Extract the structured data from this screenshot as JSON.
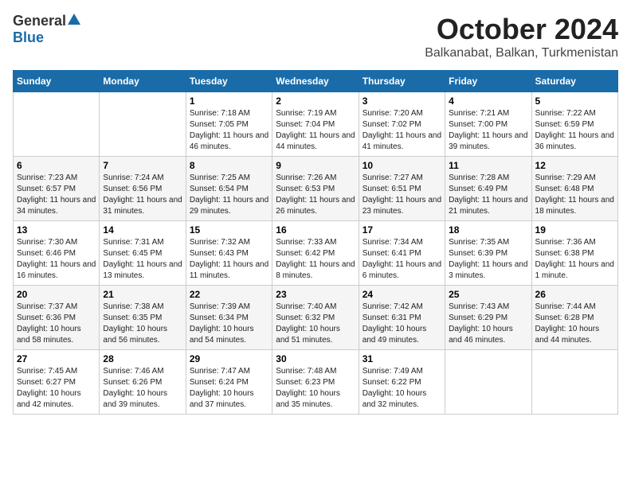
{
  "header": {
    "logo_general": "General",
    "logo_blue": "Blue",
    "month": "October 2024",
    "location": "Balkanabat, Balkan, Turkmenistan"
  },
  "weekdays": [
    "Sunday",
    "Monday",
    "Tuesday",
    "Wednesday",
    "Thursday",
    "Friday",
    "Saturday"
  ],
  "weeks": [
    [
      {
        "day": "",
        "info": ""
      },
      {
        "day": "",
        "info": ""
      },
      {
        "day": "1",
        "info": "Sunrise: 7:18 AM\nSunset: 7:05 PM\nDaylight: 11 hours and 46 minutes."
      },
      {
        "day": "2",
        "info": "Sunrise: 7:19 AM\nSunset: 7:04 PM\nDaylight: 11 hours and 44 minutes."
      },
      {
        "day": "3",
        "info": "Sunrise: 7:20 AM\nSunset: 7:02 PM\nDaylight: 11 hours and 41 minutes."
      },
      {
        "day": "4",
        "info": "Sunrise: 7:21 AM\nSunset: 7:00 PM\nDaylight: 11 hours and 39 minutes."
      },
      {
        "day": "5",
        "info": "Sunrise: 7:22 AM\nSunset: 6:59 PM\nDaylight: 11 hours and 36 minutes."
      }
    ],
    [
      {
        "day": "6",
        "info": "Sunrise: 7:23 AM\nSunset: 6:57 PM\nDaylight: 11 hours and 34 minutes."
      },
      {
        "day": "7",
        "info": "Sunrise: 7:24 AM\nSunset: 6:56 PM\nDaylight: 11 hours and 31 minutes."
      },
      {
        "day": "8",
        "info": "Sunrise: 7:25 AM\nSunset: 6:54 PM\nDaylight: 11 hours and 29 minutes."
      },
      {
        "day": "9",
        "info": "Sunrise: 7:26 AM\nSunset: 6:53 PM\nDaylight: 11 hours and 26 minutes."
      },
      {
        "day": "10",
        "info": "Sunrise: 7:27 AM\nSunset: 6:51 PM\nDaylight: 11 hours and 23 minutes."
      },
      {
        "day": "11",
        "info": "Sunrise: 7:28 AM\nSunset: 6:49 PM\nDaylight: 11 hours and 21 minutes."
      },
      {
        "day": "12",
        "info": "Sunrise: 7:29 AM\nSunset: 6:48 PM\nDaylight: 11 hours and 18 minutes."
      }
    ],
    [
      {
        "day": "13",
        "info": "Sunrise: 7:30 AM\nSunset: 6:46 PM\nDaylight: 11 hours and 16 minutes."
      },
      {
        "day": "14",
        "info": "Sunrise: 7:31 AM\nSunset: 6:45 PM\nDaylight: 11 hours and 13 minutes."
      },
      {
        "day": "15",
        "info": "Sunrise: 7:32 AM\nSunset: 6:43 PM\nDaylight: 11 hours and 11 minutes."
      },
      {
        "day": "16",
        "info": "Sunrise: 7:33 AM\nSunset: 6:42 PM\nDaylight: 11 hours and 8 minutes."
      },
      {
        "day": "17",
        "info": "Sunrise: 7:34 AM\nSunset: 6:41 PM\nDaylight: 11 hours and 6 minutes."
      },
      {
        "day": "18",
        "info": "Sunrise: 7:35 AM\nSunset: 6:39 PM\nDaylight: 11 hours and 3 minutes."
      },
      {
        "day": "19",
        "info": "Sunrise: 7:36 AM\nSunset: 6:38 PM\nDaylight: 11 hours and 1 minute."
      }
    ],
    [
      {
        "day": "20",
        "info": "Sunrise: 7:37 AM\nSunset: 6:36 PM\nDaylight: 10 hours and 58 minutes."
      },
      {
        "day": "21",
        "info": "Sunrise: 7:38 AM\nSunset: 6:35 PM\nDaylight: 10 hours and 56 minutes."
      },
      {
        "day": "22",
        "info": "Sunrise: 7:39 AM\nSunset: 6:34 PM\nDaylight: 10 hours and 54 minutes."
      },
      {
        "day": "23",
        "info": "Sunrise: 7:40 AM\nSunset: 6:32 PM\nDaylight: 10 hours and 51 minutes."
      },
      {
        "day": "24",
        "info": "Sunrise: 7:42 AM\nSunset: 6:31 PM\nDaylight: 10 hours and 49 minutes."
      },
      {
        "day": "25",
        "info": "Sunrise: 7:43 AM\nSunset: 6:29 PM\nDaylight: 10 hours and 46 minutes."
      },
      {
        "day": "26",
        "info": "Sunrise: 7:44 AM\nSunset: 6:28 PM\nDaylight: 10 hours and 44 minutes."
      }
    ],
    [
      {
        "day": "27",
        "info": "Sunrise: 7:45 AM\nSunset: 6:27 PM\nDaylight: 10 hours and 42 minutes."
      },
      {
        "day": "28",
        "info": "Sunrise: 7:46 AM\nSunset: 6:26 PM\nDaylight: 10 hours and 39 minutes."
      },
      {
        "day": "29",
        "info": "Sunrise: 7:47 AM\nSunset: 6:24 PM\nDaylight: 10 hours and 37 minutes."
      },
      {
        "day": "30",
        "info": "Sunrise: 7:48 AM\nSunset: 6:23 PM\nDaylight: 10 hours and 35 minutes."
      },
      {
        "day": "31",
        "info": "Sunrise: 7:49 AM\nSunset: 6:22 PM\nDaylight: 10 hours and 32 minutes."
      },
      {
        "day": "",
        "info": ""
      },
      {
        "day": "",
        "info": ""
      }
    ]
  ]
}
